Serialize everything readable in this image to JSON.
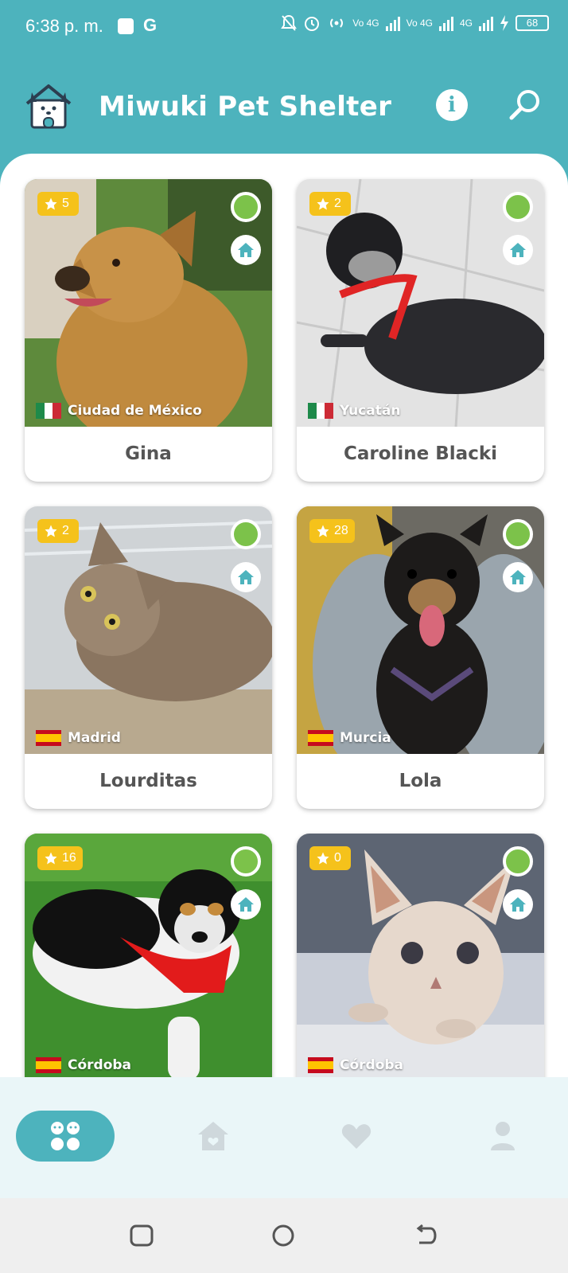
{
  "status_bar": {
    "time": "6:38 p. m.",
    "g_label": "G",
    "net1": "Vo 4G",
    "net2": "Vo 4G",
    "net3": "4G",
    "battery": "68"
  },
  "app_bar": {
    "title": "Miwuki Pet Shelter",
    "info_label": "i"
  },
  "pets": [
    {
      "name": "Gina",
      "rating": "5",
      "location": "Ciudad de México",
      "flag": "mx"
    },
    {
      "name": "Caroline Blacki",
      "rating": "2",
      "location": "Yucatán",
      "flag": "mx"
    },
    {
      "name": "Lourditas",
      "rating": "2",
      "location": "Madrid",
      "flag": "es"
    },
    {
      "name": "Lola",
      "rating": "28",
      "location": "Murcia",
      "flag": "es"
    },
    {
      "name": "",
      "rating": "16",
      "location": "Córdoba",
      "flag": "es"
    },
    {
      "name": "",
      "rating": "0",
      "location": "Córdoba",
      "flag": "es"
    }
  ],
  "colors": {
    "primary": "#4db3bd",
    "badge": "#f5c21b",
    "available": "#7cc24a"
  },
  "bottom_nav": {
    "items": [
      "pets-icon",
      "shelter-icon",
      "favorites-icon",
      "profile-icon"
    ],
    "active": "pets-icon"
  }
}
